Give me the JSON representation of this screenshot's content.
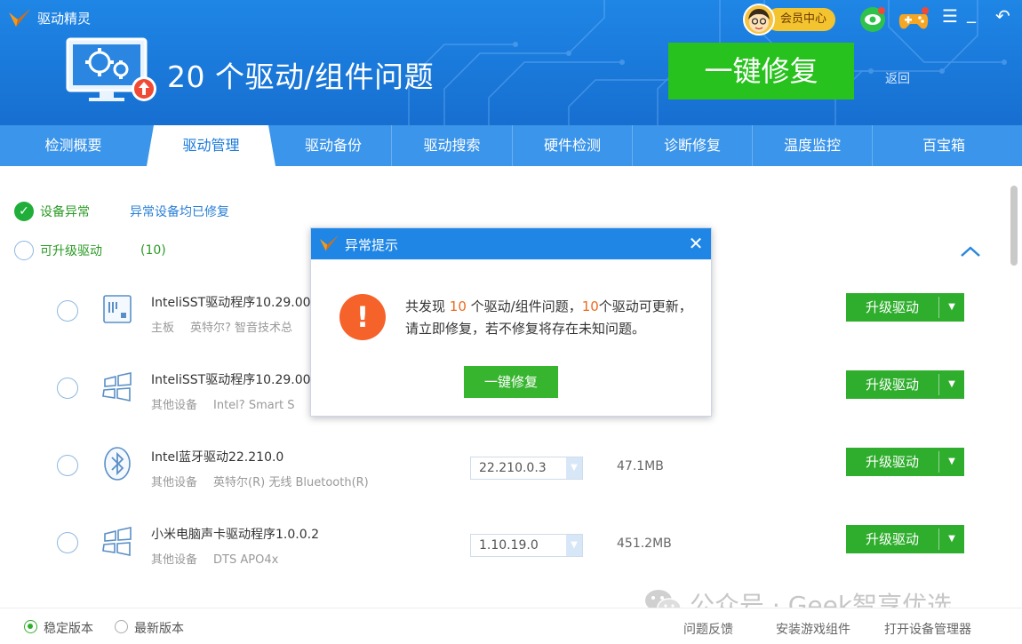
{
  "app": {
    "name": "驱动精灵"
  },
  "header": {
    "headline": "20 个驱动/组件问题",
    "fix_button": "一键修复",
    "back_link": "返回",
    "vip_label": "会员中心"
  },
  "tabs": [
    {
      "label": "检测概要",
      "active": false
    },
    {
      "label": "驱动管理",
      "active": true
    },
    {
      "label": "驱动备份",
      "active": false
    },
    {
      "label": "驱动搜索",
      "active": false
    },
    {
      "label": "硬件检测",
      "active": false
    },
    {
      "label": "诊断修复",
      "active": false
    },
    {
      "label": "温度监控",
      "active": false
    },
    {
      "label": "百宝箱",
      "active": false
    }
  ],
  "status": {
    "device_abnormal": "设备异常",
    "device_fixed": "异常设备均已修复",
    "upgradable": "可升级驱动",
    "upgradable_count": "(10)"
  },
  "drivers": [
    {
      "name": "InteliSST驱动程序10.29.00",
      "category": "主板",
      "vendor": "英特尔? 智音技术总",
      "version": "",
      "size": "",
      "icon": "chip-icon",
      "upgrade_label": "升级驱动"
    },
    {
      "name": "InteliSST驱动程序10.29.00",
      "category": "其他设备",
      "vendor": "Intel? Smart S",
      "version": "",
      "size": "",
      "icon": "windows-icon",
      "upgrade_label": "升级驱动"
    },
    {
      "name": "Intel蓝牙驱动22.210.0",
      "category": "其他设备",
      "vendor": "英特尔(R) 无线 Bluetooth(R)",
      "version": "22.210.0.3",
      "size": "47.1MB",
      "icon": "bluetooth-icon",
      "upgrade_label": "升级驱动"
    },
    {
      "name": "小米电脑声卡驱动程序1.0.0.2",
      "category": "其他设备",
      "vendor": "DTS APO4x",
      "version": "1.10.19.0",
      "size": "451.2MB",
      "icon": "windows-icon",
      "upgrade_label": "升级驱动"
    }
  ],
  "bottom": {
    "stable": "稳定版本",
    "latest": "最新版本",
    "feedback": "问题反馈",
    "game_components": "安装游戏组件",
    "device_manager": "打开设备管理器"
  },
  "watermark": {
    "text": "公众号 · Geek智享优选"
  },
  "dialog": {
    "title": "异常提示",
    "msg_part1": "共发现 ",
    "msg_count1": "10",
    "msg_part2": " 个驱动/组件问题，",
    "msg_count2": "10",
    "msg_part3": "个驱动可更新，请立即修复，若不修复将存在未知问题。",
    "button": "一键修复"
  },
  "colors": {
    "header_blue": "#1a79da",
    "tab_blue": "#3b95ea",
    "primary_green": "#27c21d",
    "upgrade_green": "#2fae2d",
    "highlight_orange": "#ee6a1f",
    "warn_orange": "#f5622a"
  }
}
